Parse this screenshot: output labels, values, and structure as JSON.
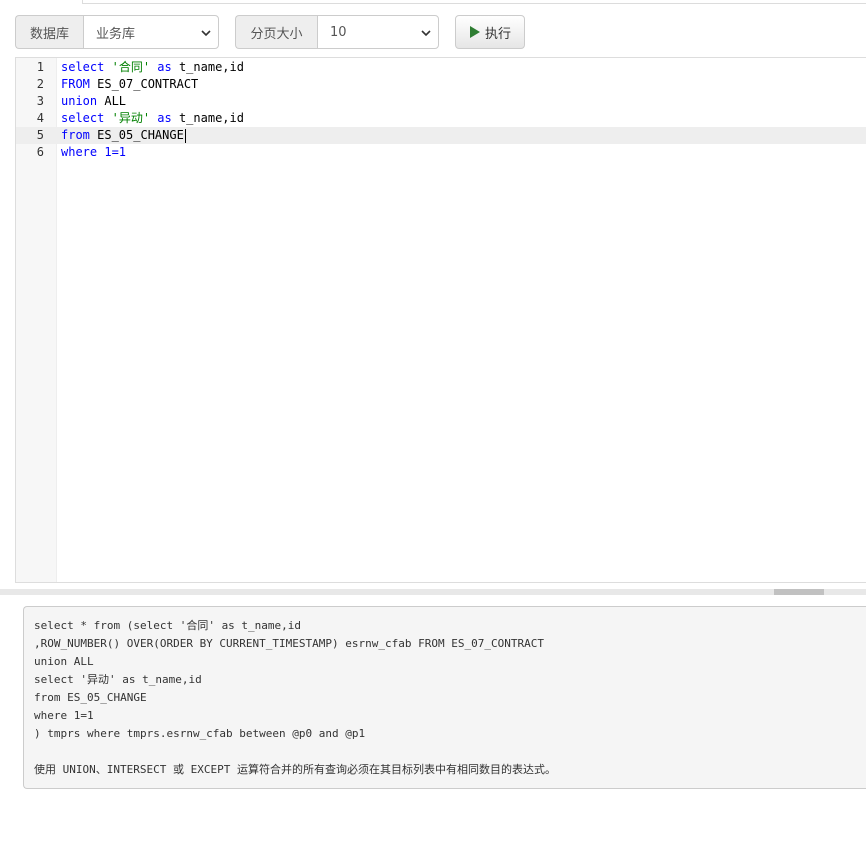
{
  "toolbar": {
    "database_label": "数据库",
    "database_value": "业务库",
    "pagesize_label": "分页大小",
    "pagesize_value": "10",
    "run_label": "执行"
  },
  "editor": {
    "lines": [
      {
        "no": "1",
        "segments": [
          {
            "t": "select",
            "c": "kw"
          },
          {
            "t": " ",
            "c": ""
          },
          {
            "t": "'合同'",
            "c": "str"
          },
          {
            "t": " ",
            "c": ""
          },
          {
            "t": "as",
            "c": "kw"
          },
          {
            "t": " t_name,id",
            "c": ""
          }
        ]
      },
      {
        "no": "2",
        "segments": [
          {
            "t": "FROM",
            "c": "kw"
          },
          {
            "t": " ES_07_CONTRACT",
            "c": ""
          }
        ]
      },
      {
        "no": "3",
        "segments": [
          {
            "t": "union",
            "c": "kw"
          },
          {
            "t": " ALL",
            "c": ""
          }
        ]
      },
      {
        "no": "4",
        "segments": [
          {
            "t": "select",
            "c": "kw"
          },
          {
            "t": " ",
            "c": ""
          },
          {
            "t": "'异动'",
            "c": "str"
          },
          {
            "t": " ",
            "c": ""
          },
          {
            "t": "as",
            "c": "kw"
          },
          {
            "t": " t_name,id",
            "c": ""
          }
        ]
      },
      {
        "no": "5",
        "segments": [
          {
            "t": "from",
            "c": "kw"
          },
          {
            "t": " ES_05_CHANGE",
            "c": ""
          }
        ],
        "active": true
      },
      {
        "no": "6",
        "segments": [
          {
            "t": "where",
            "c": "kw"
          },
          {
            "t": " 1=1",
            "c": "kw"
          }
        ]
      }
    ]
  },
  "result": {
    "sql_lines": [
      "select * from (select '合同' as t_name,id",
      ",ROW_NUMBER() OVER(ORDER BY CURRENT_TIMESTAMP) esrnw_cfab FROM ES_07_CONTRACT",
      "union ALL",
      "select '异动' as t_name,id",
      "from ES_05_CHANGE",
      "where 1=1",
      ") tmprs where tmprs.esrnw_cfab between @p0 and @p1"
    ],
    "error_message": "使用 UNION、INTERSECT 或 EXCEPT 运算符合并的所有查询必须在其目标列表中有相同数目的表达式。"
  },
  "colors": {
    "keyword": "#0000ff",
    "string": "#008000",
    "play_icon": "#2e7d32"
  }
}
